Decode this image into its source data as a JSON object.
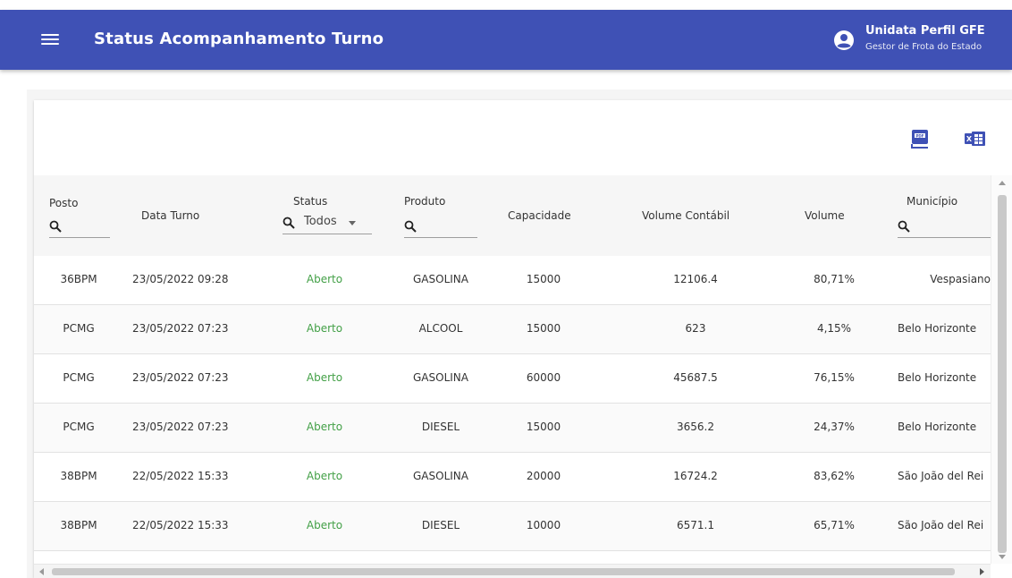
{
  "header": {
    "title": "Status Acompanhamento Turno",
    "user_name": "Unidata Perfil GFE",
    "user_role": "Gestor de Frota do Estado",
    "bar_color": "#3f51b5"
  },
  "toolbar": {
    "pdf_icon": "pdf-export-icon",
    "excel_icon": "excel-export-icon"
  },
  "table": {
    "columns": {
      "posto": "Posto",
      "data_turno": "Data Turno",
      "status": "Status",
      "produto": "Produto",
      "capacidade": "Capacidade",
      "volume_contabil": "Volume Contábil",
      "volume": "Volume",
      "municipio": "Município"
    },
    "status_filter_value": "Todos",
    "rows": [
      {
        "posto": "36BPM",
        "data_turno": "23/05/2022 09:28",
        "status": "Aberto",
        "produto": "GASOLINA",
        "capacidade": "15000",
        "volume_contabil": "12106.4",
        "volume": "80,71%",
        "municipio": "Vespasiano"
      },
      {
        "posto": "PCMG",
        "data_turno": "23/05/2022 07:23",
        "status": "Aberto",
        "produto": "ALCOOL",
        "capacidade": "15000",
        "volume_contabil": "623",
        "volume": "4,15%",
        "municipio": "Belo Horizonte"
      },
      {
        "posto": "PCMG",
        "data_turno": "23/05/2022 07:23",
        "status": "Aberto",
        "produto": "GASOLINA",
        "capacidade": "60000",
        "volume_contabil": "45687.5",
        "volume": "76,15%",
        "municipio": "Belo Horizonte"
      },
      {
        "posto": "PCMG",
        "data_turno": "23/05/2022 07:23",
        "status": "Aberto",
        "produto": "DIESEL",
        "capacidade": "15000",
        "volume_contabil": "3656.2",
        "volume": "24,37%",
        "municipio": "Belo Horizonte"
      },
      {
        "posto": "38BPM",
        "data_turno": "22/05/2022 15:33",
        "status": "Aberto",
        "produto": "GASOLINA",
        "capacidade": "20000",
        "volume_contabil": "16724.2",
        "volume": "83,62%",
        "municipio": "São João del Rei"
      },
      {
        "posto": "38BPM",
        "data_turno": "22/05/2022 15:33",
        "status": "Aberto",
        "produto": "DIESEL",
        "capacidade": "10000",
        "volume_contabil": "6571.1",
        "volume": "65,71%",
        "municipio": "São João del Rei"
      }
    ],
    "status_color": "#43a047"
  }
}
